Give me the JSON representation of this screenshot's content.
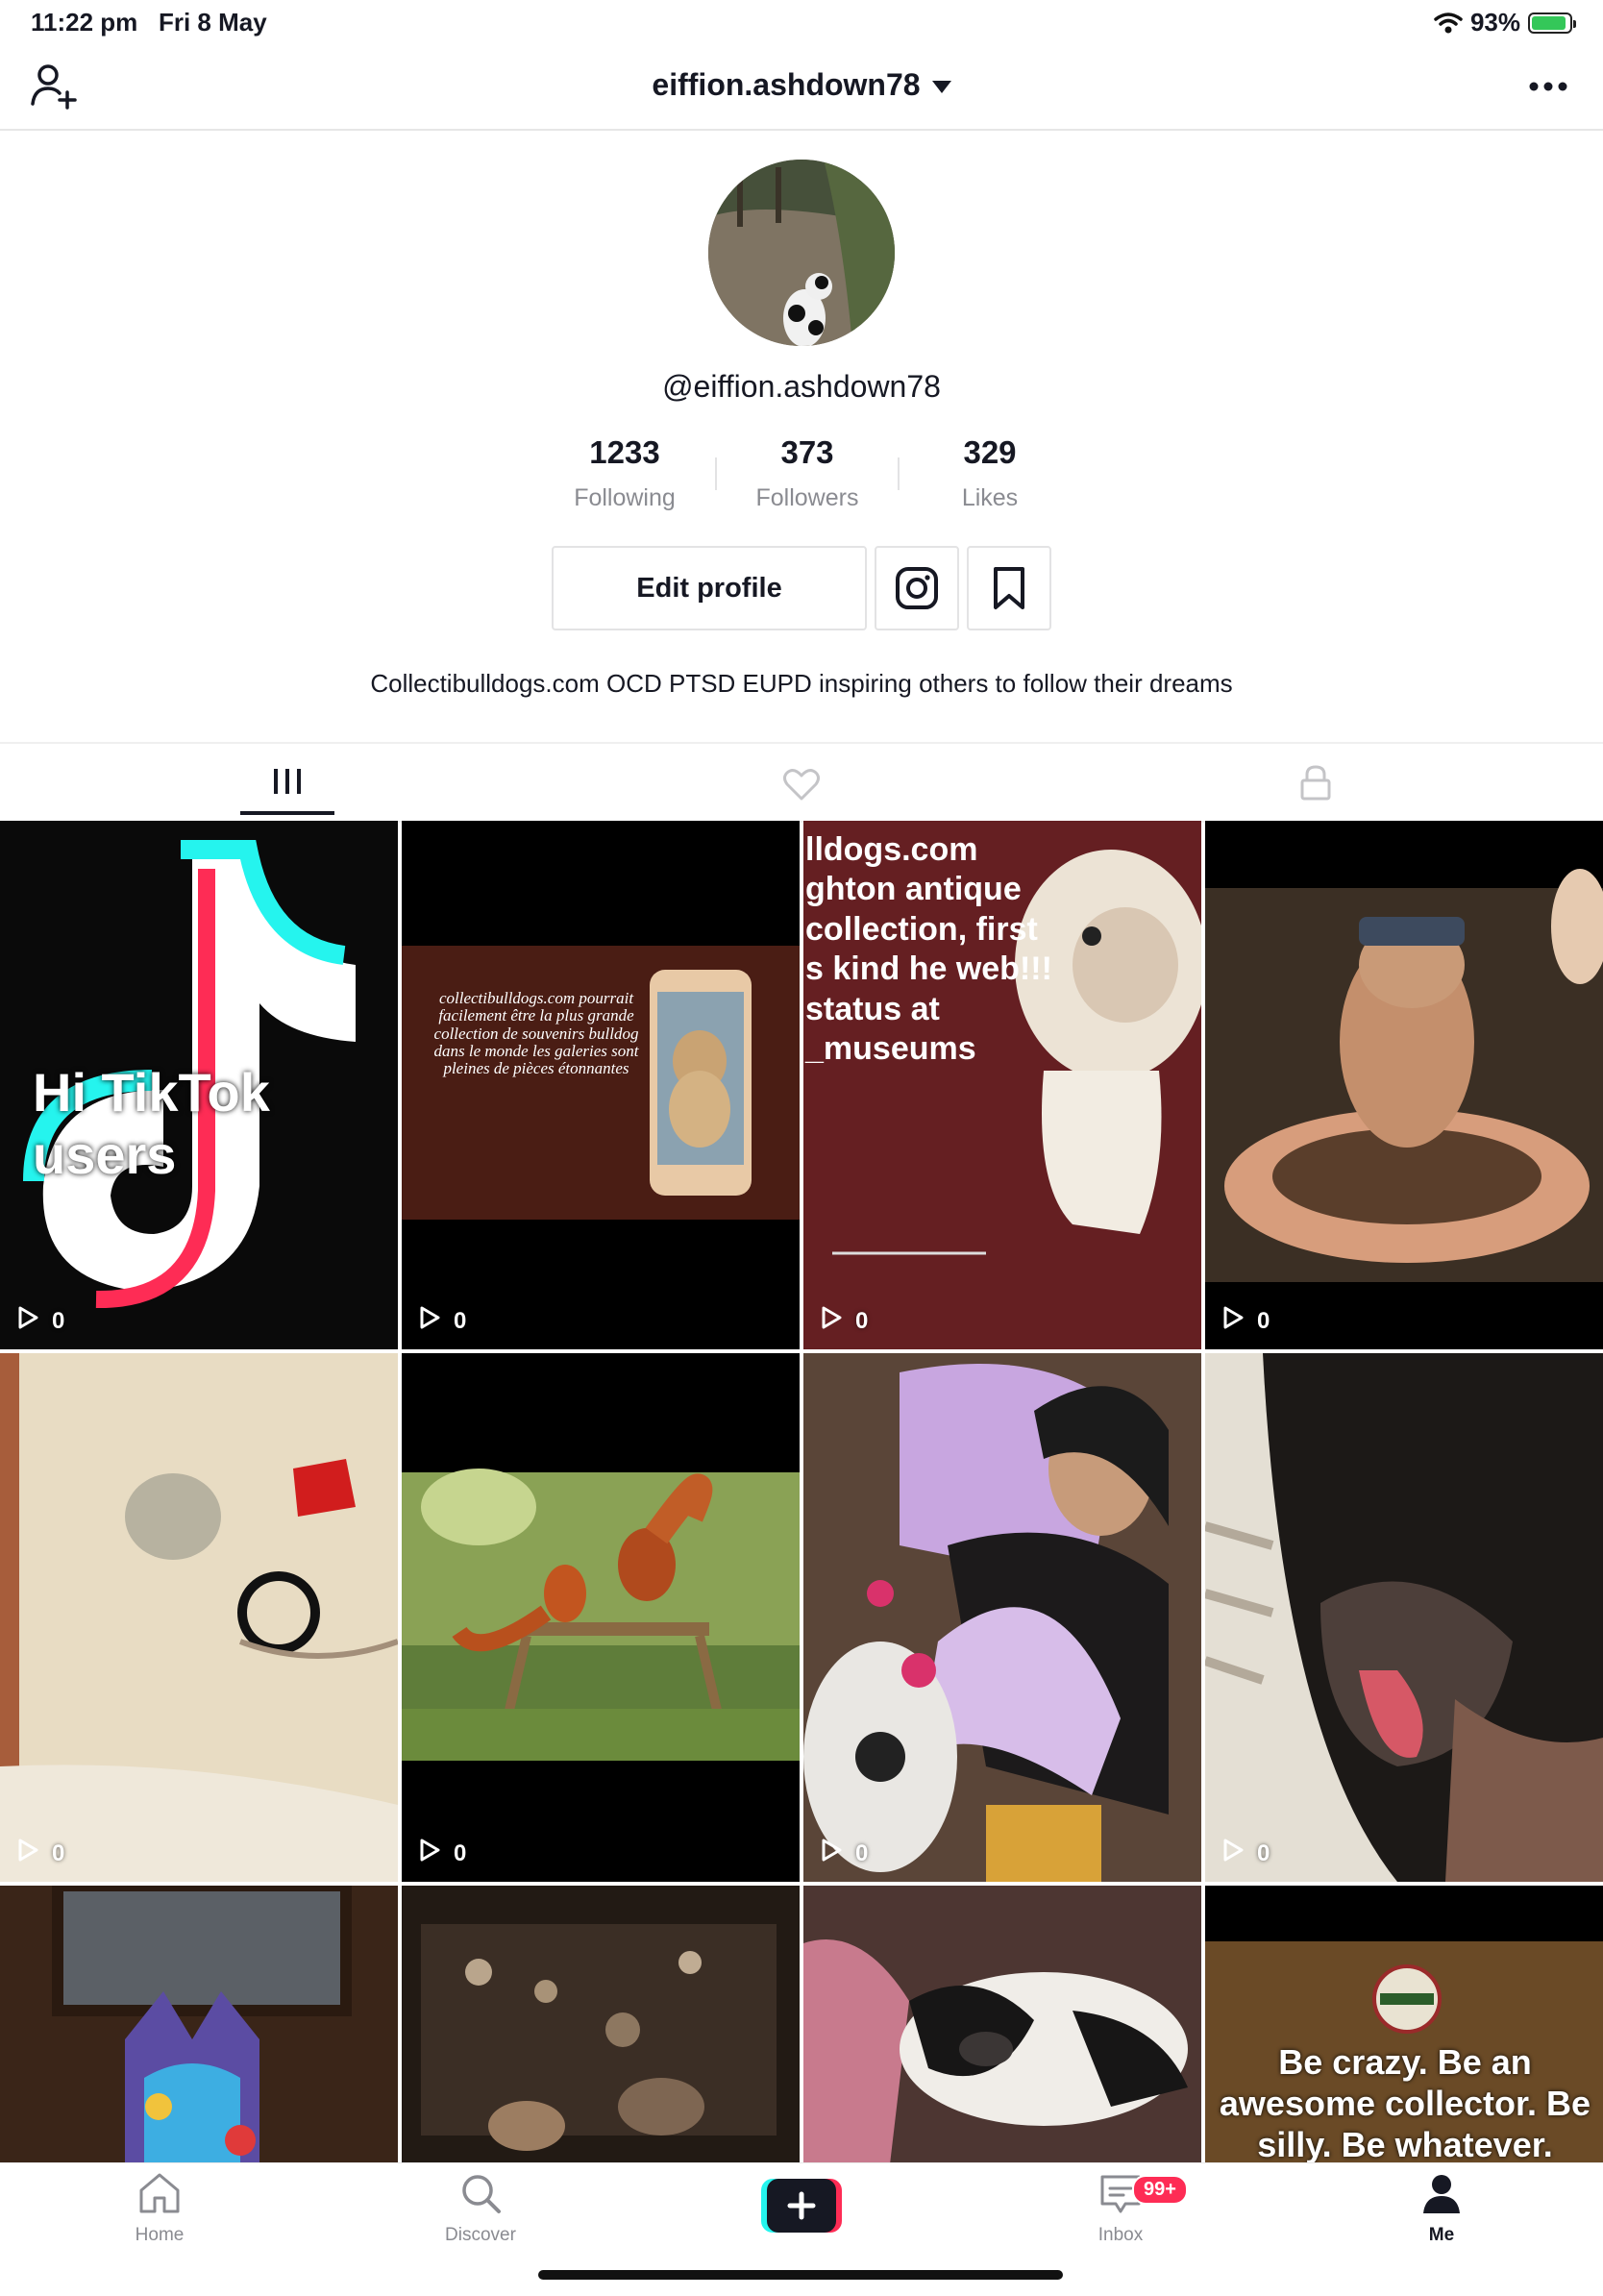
{
  "status": {
    "time": "11:22 pm",
    "date": "Fri 8 May",
    "battery": "93%",
    "battery_level": 0.93
  },
  "nav": {
    "title": "eiffion.ashdown78"
  },
  "profile": {
    "handle": "@eiffion.ashdown78",
    "stats": [
      {
        "value": "1233",
        "label": "Following"
      },
      {
        "value": "373",
        "label": "Followers"
      },
      {
        "value": "329",
        "label": "Likes"
      }
    ],
    "edit_label": "Edit profile",
    "bio": "Collectibulldogs.com OCD PTSD EUPD inspiring others to follow their dreams"
  },
  "tabs": [
    "videos-tab",
    "liked-tab",
    "private-tab"
  ],
  "videos": [
    {
      "views": "0",
      "overlay": "Hi TikTok users"
    },
    {
      "views": "0",
      "overlay": "collectibulldogs.com pourrait facilement être la plus grande collection de souvenirs bulldog dans le monde les galeries sont pleines de pièces étonnantes"
    },
    {
      "views": "0",
      "overlay": "lldogs.com ghton antique collection, first s kind he web!!! status at _museums"
    },
    {
      "views": "0",
      "overlay": ""
    },
    {
      "views": "0",
      "overlay": ""
    },
    {
      "views": "0",
      "overlay": ""
    },
    {
      "views": "0",
      "overlay": ""
    },
    {
      "views": "0",
      "overlay": ""
    },
    {
      "views": "",
      "overlay": ""
    },
    {
      "views": "",
      "overlay": ""
    },
    {
      "views": "",
      "overlay": ""
    },
    {
      "views": "",
      "overlay": "Be crazy. Be an awesome collector. Be silly. Be whatever."
    }
  ],
  "bottom_nav": {
    "home": "Home",
    "discover": "Discover",
    "inbox": "Inbox",
    "inbox_badge": "99+",
    "me": "Me"
  }
}
